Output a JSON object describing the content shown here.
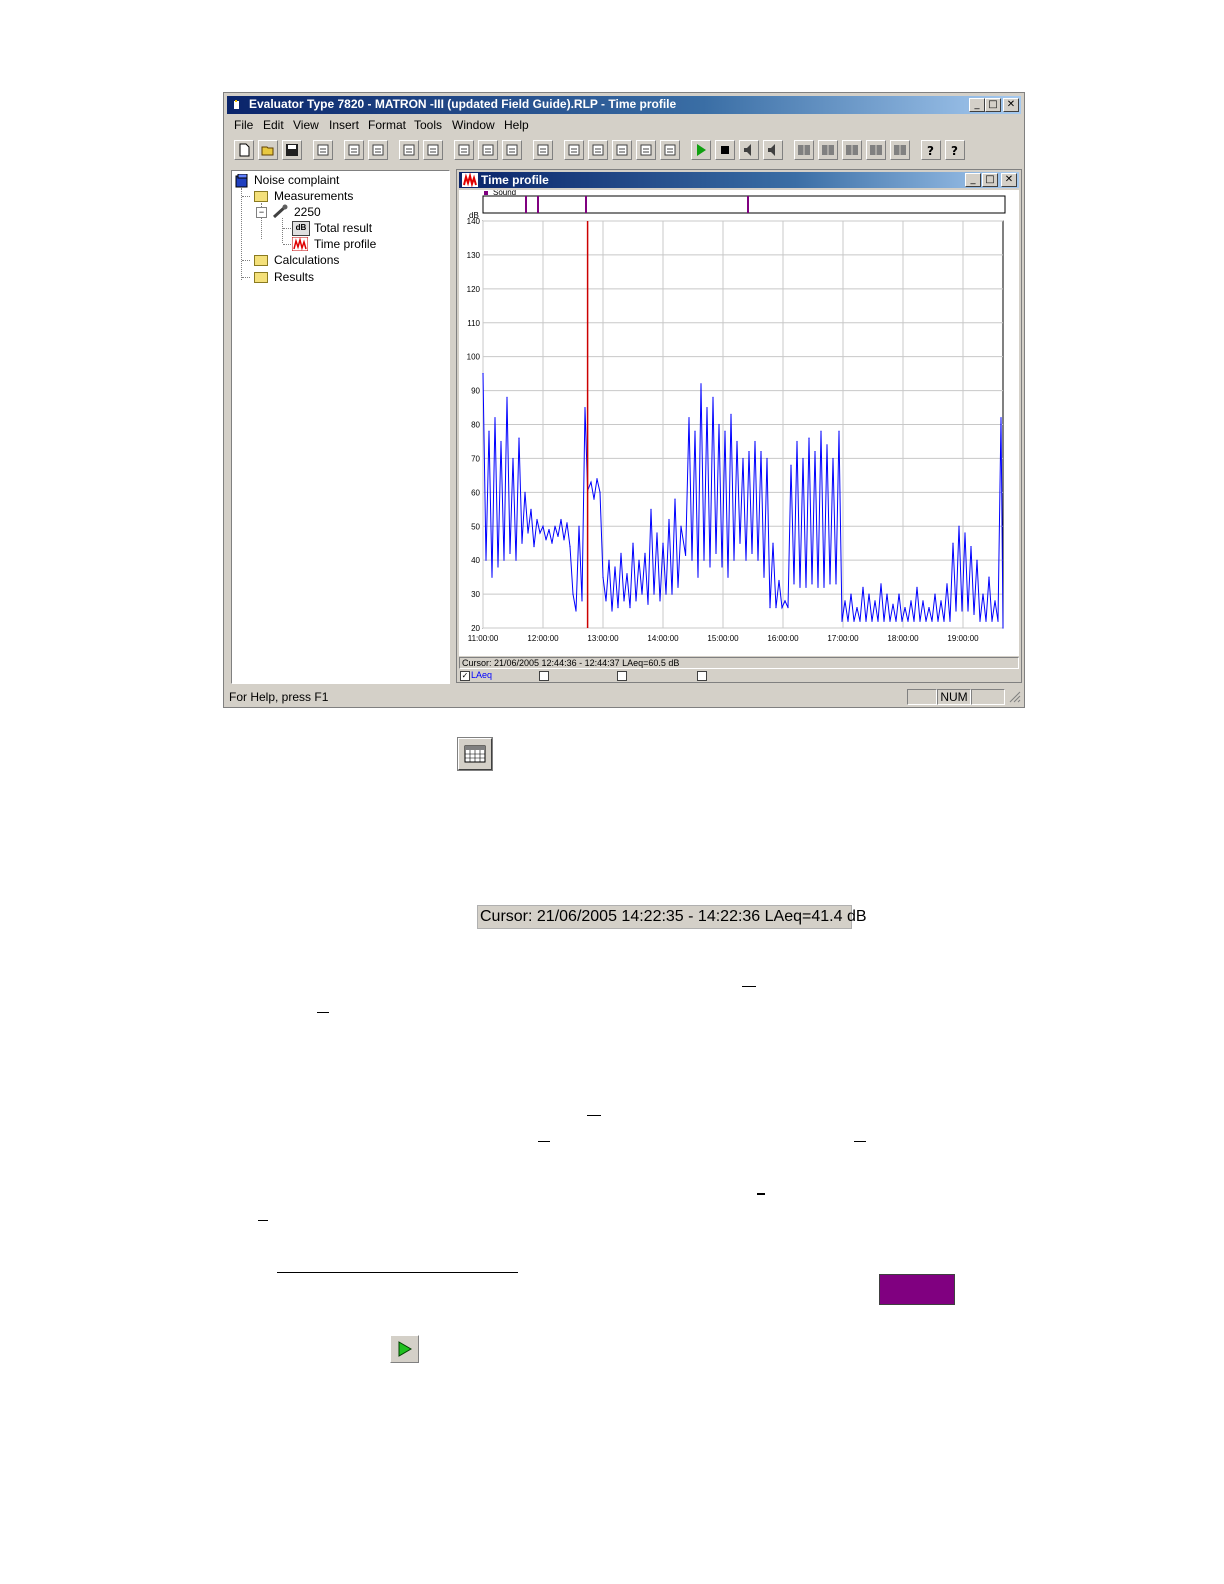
{
  "window": {
    "title": "Evaluator Type 7820 - MATRON -III (updated Field Guide).RLP - Time profile",
    "minimize": "_",
    "maximize": "□",
    "close": "✕"
  },
  "menu": [
    "File",
    "Edit",
    "View",
    "Insert",
    "Format",
    "Tools",
    "Window",
    "Help"
  ],
  "toolbar_icons": [
    "new-icon",
    "open-icon",
    "save-icon",
    "copy-icon",
    "print-preview-icon",
    "print-icon",
    "find-icon",
    "edit-icon",
    "calendar-icon",
    "tools-icon",
    "export-icon",
    "tree-icon",
    "chart1-icon",
    "chart2-icon",
    "chart3-icon",
    "chart4-icon",
    "chart5-icon",
    "play-icon",
    "stop-icon",
    "speaker-on-icon",
    "speaker-off-icon",
    "layout1-icon",
    "layout2-icon",
    "layout3-icon",
    "layout4-icon",
    "layout5-icon",
    "help-icon",
    "context-help-icon"
  ],
  "tree": {
    "root": "Noise complaint",
    "measurements": "Measurements",
    "device": "2250",
    "total_result": "Total result",
    "total_result_badge": "dB",
    "time_profile": "Time profile",
    "calculations": "Calculations",
    "results": "Results"
  },
  "child_window": {
    "title": "Time profile",
    "marker_legend": "Sound",
    "cursor_text": "Cursor: 21/06/2005 12:44:36 - 12:44:37  LAeq=60.5 dB",
    "legend_series": "LAeq"
  },
  "status": {
    "help": "For Help, press F1",
    "num": "NUM"
  },
  "below": {
    "cursor_readout": "Cursor: 21/06/2005 14:22:35 - 14:22:36  LAeq=41.4 dB"
  },
  "colors": {
    "series": "#0000ff",
    "cursor_line": "#cc0000",
    "marker": "#800080",
    "swatch": "#800080"
  },
  "chart_data": {
    "type": "line",
    "ylabel": "dB",
    "ylim": [
      20,
      140
    ],
    "yticks": [
      140,
      130,
      120,
      110,
      100,
      90,
      80,
      70,
      60,
      50,
      40,
      30,
      20
    ],
    "xticks": [
      "11:00:00",
      "12:00:00",
      "13:00:00",
      "14:00:00",
      "15:00:00",
      "16:00:00",
      "17:00:00",
      "18:00:00",
      "19:00:00"
    ],
    "xlim": [
      "11:00:00",
      "19:40:00"
    ],
    "grid": true,
    "cursor_time": "12:44:36",
    "sound_markers": [
      "11:43:00",
      "11:55:00",
      "12:43:00",
      "15:25:00"
    ],
    "series": [
      {
        "name": "LAeq",
        "points": [
          [
            "11:00:00",
            95
          ],
          [
            "11:03:00",
            40
          ],
          [
            "11:06:00",
            78
          ],
          [
            "11:09:00",
            35
          ],
          [
            "11:12:00",
            82
          ],
          [
            "11:15:00",
            38
          ],
          [
            "11:18:00",
            75
          ],
          [
            "11:21:00",
            40
          ],
          [
            "11:24:00",
            88
          ],
          [
            "11:27:00",
            42
          ],
          [
            "11:30:00",
            70
          ],
          [
            "11:33:00",
            40
          ],
          [
            "11:36:00",
            76
          ],
          [
            "11:39:00",
            45
          ],
          [
            "11:42:00",
            60
          ],
          [
            "11:45:00",
            48
          ],
          [
            "11:48:00",
            55
          ],
          [
            "11:51:00",
            44
          ],
          [
            "11:54:00",
            52
          ],
          [
            "11:57:00",
            48
          ],
          [
            "12:00:00",
            50
          ],
          [
            "12:03:00",
            46
          ],
          [
            "12:06:00",
            49
          ],
          [
            "12:09:00",
            45
          ],
          [
            "12:12:00",
            50
          ],
          [
            "12:15:00",
            47
          ],
          [
            "12:18:00",
            52
          ],
          [
            "12:21:00",
            46
          ],
          [
            "12:24:00",
            51
          ],
          [
            "12:27:00",
            44
          ],
          [
            "12:30:00",
            30
          ],
          [
            "12:33:00",
            25
          ],
          [
            "12:36:00",
            50
          ],
          [
            "12:39:00",
            28
          ],
          [
            "12:42:00",
            85
          ],
          [
            "12:44:36",
            60.5
          ],
          [
            "12:48:00",
            63
          ],
          [
            "12:51:00",
            58
          ],
          [
            "12:54:00",
            64
          ],
          [
            "12:57:00",
            60
          ],
          [
            "13:00:00",
            35
          ],
          [
            "13:03:00",
            28
          ],
          [
            "13:06:00",
            40
          ],
          [
            "13:09:00",
            25
          ],
          [
            "13:12:00",
            38
          ],
          [
            "13:15:00",
            26
          ],
          [
            "13:18:00",
            42
          ],
          [
            "13:21:00",
            28
          ],
          [
            "13:24:00",
            36
          ],
          [
            "13:27:00",
            26
          ],
          [
            "13:30:00",
            45
          ],
          [
            "13:33:00",
            28
          ],
          [
            "13:36:00",
            40
          ],
          [
            "13:39:00",
            30
          ],
          [
            "13:42:00",
            42
          ],
          [
            "13:45:00",
            27
          ],
          [
            "13:48:00",
            55
          ],
          [
            "13:51:00",
            30
          ],
          [
            "13:54:00",
            48
          ],
          [
            "13:57:00",
            28
          ],
          [
            "14:00:00",
            45
          ],
          [
            "14:03:00",
            30
          ],
          [
            "14:06:00",
            52
          ],
          [
            "14:09:00",
            30
          ],
          [
            "14:12:00",
            58
          ],
          [
            "14:15:00",
            32
          ],
          [
            "14:18:00",
            50
          ],
          [
            "14:22:35",
            41.4
          ],
          [
            "14:26:00",
            82
          ],
          [
            "14:29:00",
            40
          ],
          [
            "14:32:00",
            78
          ],
          [
            "14:35:00",
            35
          ],
          [
            "14:38:00",
            92
          ],
          [
            "14:41:00",
            40
          ],
          [
            "14:44:00",
            85
          ],
          [
            "14:47:00",
            38
          ],
          [
            "14:50:00",
            88
          ],
          [
            "14:53:00",
            42
          ],
          [
            "14:56:00",
            80
          ],
          [
            "14:59:00",
            38
          ],
          [
            "15:02:00",
            78
          ],
          [
            "15:05:00",
            35
          ],
          [
            "15:08:00",
            83
          ],
          [
            "15:11:00",
            40
          ],
          [
            "15:14:00",
            75
          ],
          [
            "15:17:00",
            45
          ],
          [
            "15:20:00",
            70
          ],
          [
            "15:23:00",
            40
          ],
          [
            "15:26:00",
            72
          ],
          [
            "15:29:00",
            42
          ],
          [
            "15:32:00",
            75
          ],
          [
            "15:35:00",
            40
          ],
          [
            "15:38:00",
            72
          ],
          [
            "15:41:00",
            35
          ],
          [
            "15:44:00",
            70
          ],
          [
            "15:47:00",
            26
          ],
          [
            "15:50:00",
            45
          ],
          [
            "15:53:00",
            26
          ],
          [
            "15:56:00",
            34
          ],
          [
            "15:59:00",
            26
          ],
          [
            "16:02:00",
            28
          ],
          [
            "16:05:00",
            26
          ],
          [
            "16:08:00",
            68
          ],
          [
            "16:11:00",
            33
          ],
          [
            "16:14:00",
            75
          ],
          [
            "16:17:00",
            32
          ],
          [
            "16:20:00",
            70
          ],
          [
            "16:23:00",
            32
          ],
          [
            "16:26:00",
            76
          ],
          [
            "16:29:00",
            33
          ],
          [
            "16:32:00",
            72
          ],
          [
            "16:35:00",
            32
          ],
          [
            "16:38:00",
            78
          ],
          [
            "16:41:00",
            32
          ],
          [
            "16:44:00",
            74
          ],
          [
            "16:47:00",
            33
          ],
          [
            "16:50:00",
            70
          ],
          [
            "16:53:00",
            33
          ],
          [
            "16:56:00",
            78
          ],
          [
            "16:59:00",
            22
          ],
          [
            "17:02:00",
            28
          ],
          [
            "17:05:00",
            22
          ],
          [
            "17:08:00",
            30
          ],
          [
            "17:11:00",
            22
          ],
          [
            "17:14:00",
            26
          ],
          [
            "17:17:00",
            22
          ],
          [
            "17:20:00",
            32
          ],
          [
            "17:23:00",
            22
          ],
          [
            "17:26:00",
            30
          ],
          [
            "17:29:00",
            22
          ],
          [
            "17:32:00",
            28
          ],
          [
            "17:35:00",
            22
          ],
          [
            "17:38:00",
            33
          ],
          [
            "17:41:00",
            22
          ],
          [
            "17:44:00",
            30
          ],
          [
            "17:47:00",
            22
          ],
          [
            "17:50:00",
            27
          ],
          [
            "17:53:00",
            22
          ],
          [
            "17:56:00",
            30
          ],
          [
            "17:59:00",
            22
          ],
          [
            "18:02:00",
            26
          ],
          [
            "18:05:00",
            22
          ],
          [
            "18:08:00",
            28
          ],
          [
            "18:11:00",
            22
          ],
          [
            "18:14:00",
            32
          ],
          [
            "18:17:00",
            22
          ],
          [
            "18:20:00",
            28
          ],
          [
            "18:23:00",
            22
          ],
          [
            "18:26:00",
            26
          ],
          [
            "18:29:00",
            22
          ],
          [
            "18:32:00",
            30
          ],
          [
            "18:35:00",
            22
          ],
          [
            "18:38:00",
            28
          ],
          [
            "18:41:00",
            22
          ],
          [
            "18:44:00",
            33
          ],
          [
            "18:47:00",
            22
          ],
          [
            "18:50:00",
            45
          ],
          [
            "18:53:00",
            25
          ],
          [
            "18:56:00",
            50
          ],
          [
            "18:59:00",
            25
          ],
          [
            "19:02:00",
            48
          ],
          [
            "19:05:00",
            25
          ],
          [
            "19:08:00",
            44
          ],
          [
            "19:11:00",
            24
          ],
          [
            "19:14:00",
            40
          ],
          [
            "19:17:00",
            22
          ],
          [
            "19:20:00",
            30
          ],
          [
            "19:23:00",
            22
          ],
          [
            "19:26:00",
            35
          ],
          [
            "19:29:00",
            22
          ],
          [
            "19:32:00",
            28
          ],
          [
            "19:35:00",
            22
          ],
          [
            "19:38:00",
            82
          ],
          [
            "19:40:00",
            20
          ]
        ]
      }
    ]
  }
}
